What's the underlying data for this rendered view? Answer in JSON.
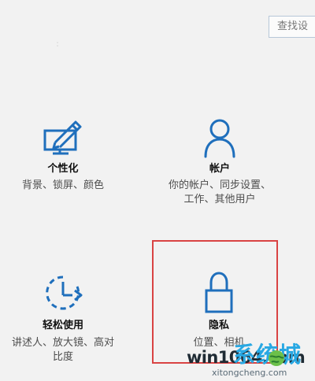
{
  "search": {
    "placeholder": "查找设"
  },
  "decor": {
    "top_dot": "˙ ˙"
  },
  "tiles": [
    {
      "title": "个性化",
      "desc": "背景、锁屏、颜色",
      "icon": "personalization-icon"
    },
    {
      "title": "帐户",
      "desc": "你的帐户、同步设置、\n工作、其他用户",
      "icon": "account-icon"
    },
    {
      "title": "轻松使用",
      "desc": "讲述人、放大镜、高对\n比度",
      "icon": "ease-of-access-icon"
    },
    {
      "title": "隐私",
      "desc": "位置、相机",
      "icon": "lock-icon"
    }
  ],
  "watermark": {
    "main": "win1064.com",
    "cn": "系统城",
    "sub": "xitongcheng.com"
  },
  "colors": {
    "accent": "#1f6fbc",
    "highlight": "#d94343",
    "watermark_blue": "#28a8e3"
  }
}
